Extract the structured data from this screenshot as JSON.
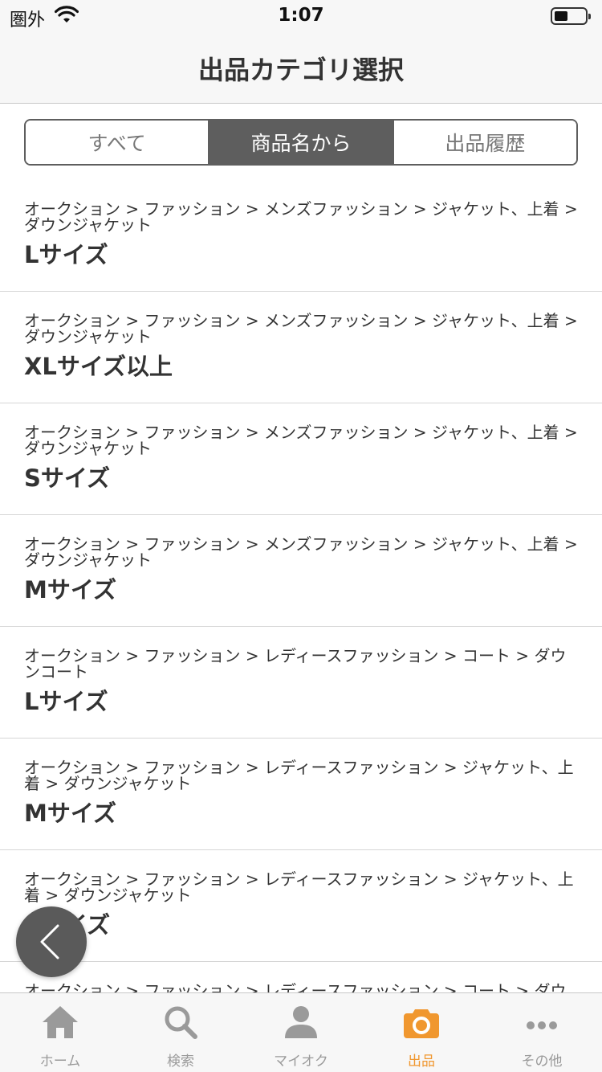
{
  "status_bar": {
    "carrier": "圏外",
    "time": "1:07"
  },
  "nav": {
    "title": "出品カテゴリ選択"
  },
  "segments": [
    {
      "label": "すべて",
      "active": false
    },
    {
      "label": "商品名から",
      "active": true
    },
    {
      "label": "出品履歴",
      "active": false
    }
  ],
  "items": [
    {
      "crumbs": "オークション > ファッション > メンズファッション > ジャケット、上着 > ダウンジャケット",
      "leaf": "Lサイズ"
    },
    {
      "crumbs": "オークション > ファッション > メンズファッション > ジャケット、上着 > ダウンジャケット",
      "leaf": "XLサイズ以上"
    },
    {
      "crumbs": "オークション > ファッション > メンズファッション > ジャケット、上着 > ダウンジャケット",
      "leaf": "Sサイズ"
    },
    {
      "crumbs": "オークション > ファッション > メンズファッション > ジャケット、上着 > ダウンジャケット",
      "leaf": "Mサイズ"
    },
    {
      "crumbs": "オークション > ファッション > レディースファッション > コート > ダウンコート",
      "leaf": "Lサイズ"
    },
    {
      "crumbs": "オークション > ファッション > レディースファッション > ジャケット、上着 > ダウンジャケット",
      "leaf": "Mサイズ"
    },
    {
      "crumbs": "オークション > ファッション > レディースファッション > ジャケット、上着 > ダウンジャケット",
      "leaf": "Sサイズ"
    },
    {
      "crumbs": "オークション > ファッション > レディースファッション > コート > ダウンコート",
      "leaf": ""
    }
  ],
  "tabs": [
    {
      "label": "ホーム",
      "icon": "home-icon",
      "active": false
    },
    {
      "label": "検索",
      "icon": "search-icon",
      "active": false
    },
    {
      "label": "マイオク",
      "icon": "person-icon",
      "active": false
    },
    {
      "label": "出品",
      "icon": "camera-icon",
      "active": true
    },
    {
      "label": "その他",
      "icon": "more-icon",
      "active": false
    }
  ],
  "colors": {
    "accent": "#f0972f",
    "segment_active": "#5e5e5e",
    "tab_inactive": "#9a9a9a"
  }
}
